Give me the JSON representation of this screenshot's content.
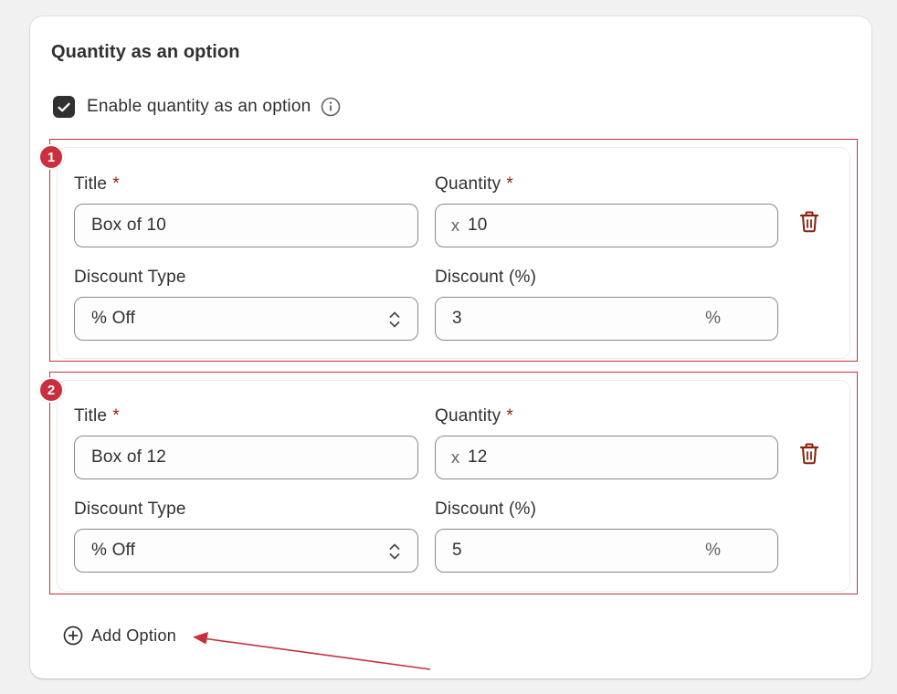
{
  "card": {
    "title": "Quantity as an option",
    "enable_checkbox": {
      "label": "Enable quantity as an option",
      "checked": true
    }
  },
  "options": [
    {
      "badge": "1",
      "title_label": "Title",
      "title_required": "*",
      "title_value": "Box of 10",
      "quantity_label": "Quantity",
      "quantity_required": "*",
      "quantity_prefix": "x",
      "quantity_value": "10",
      "discount_type_label": "Discount Type",
      "discount_type_value": "% Off",
      "discount_label": "Discount (%)",
      "discount_value": "3",
      "discount_suffix": "%"
    },
    {
      "badge": "2",
      "title_label": "Title",
      "title_required": "*",
      "title_value": "Box of 12",
      "quantity_label": "Quantity",
      "quantity_required": "*",
      "quantity_prefix": "x",
      "quantity_value": "12",
      "discount_type_label": "Discount Type",
      "discount_type_value": "% Off",
      "discount_label": "Discount (%)",
      "discount_value": "5",
      "discount_suffix": "%"
    }
  ],
  "add_option": {
    "label": "Add Option",
    "icon": "plus-circle-icon"
  },
  "colors": {
    "highlight": "#c92f3d",
    "required": "#8e1f0b",
    "trash": "#8e1f0b",
    "checkbox": "#303030"
  },
  "icons": {
    "info": "info-icon",
    "delete": "trash-icon",
    "select": "select-arrows-icon",
    "check": "checkmark-icon"
  }
}
